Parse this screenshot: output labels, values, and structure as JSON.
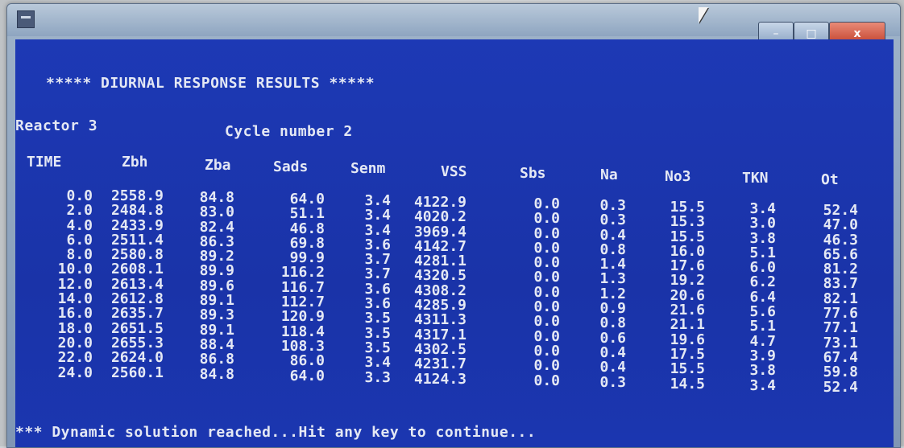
{
  "window": {
    "title": ""
  },
  "titlebar_buttons": {
    "minimize": "–",
    "maximize": "□",
    "close": "x"
  },
  "console": {
    "heading": "***** DIURNAL RESPONSE RESULTS *****",
    "reactor_label": "Reactor 3",
    "cycle_label": "Cycle number 2",
    "footer": "*** Dynamic solution reached...Hit any key to continue..."
  },
  "table": {
    "headers": [
      "TIME",
      "Zbh",
      "Zba",
      "Sads",
      "Senm",
      "VSS",
      "Sbs",
      "Na",
      "No3",
      "TKN",
      "Ot"
    ],
    "columns": {
      "time": [
        "0.0",
        "2.0",
        "4.0",
        "6.0",
        "8.0",
        "10.0",
        "12.0",
        "14.0",
        "16.0",
        "18.0",
        "20.0",
        "22.0",
        "24.0"
      ],
      "zbh": [
        "2558.9",
        "2484.8",
        "2433.9",
        "2511.4",
        "2580.8",
        "2608.1",
        "2613.4",
        "2612.8",
        "2635.7",
        "2651.5",
        "2655.3",
        "2624.0",
        "2560.1"
      ],
      "zba": [
        "84.8",
        "83.0",
        "82.4",
        "86.3",
        "89.2",
        "89.9",
        "89.6",
        "89.1",
        "89.3",
        "89.1",
        "88.4",
        "86.8",
        "84.8"
      ],
      "sads": [
        "64.0",
        "51.1",
        "46.8",
        "69.8",
        "99.9",
        "116.2",
        "116.7",
        "112.7",
        "120.9",
        "118.4",
        "108.3",
        "86.0",
        "64.0"
      ],
      "senm": [
        "3.4",
        "3.4",
        "3.4",
        "3.6",
        "3.7",
        "3.7",
        "3.6",
        "3.6",
        "3.5",
        "3.5",
        "3.5",
        "3.4",
        "3.3"
      ],
      "vss": [
        "4122.9",
        "4020.2",
        "3969.4",
        "4142.7",
        "4281.1",
        "4320.5",
        "4308.2",
        "4285.9",
        "4311.3",
        "4317.1",
        "4302.5",
        "4231.7",
        "4124.3"
      ],
      "sbs": [
        "0.0",
        "0.0",
        "0.0",
        "0.0",
        "0.0",
        "0.0",
        "0.0",
        "0.0",
        "0.0",
        "0.0",
        "0.0",
        "0.0",
        "0.0"
      ],
      "na": [
        "0.3",
        "0.3",
        "0.4",
        "0.8",
        "1.4",
        "1.3",
        "1.2",
        "0.9",
        "0.8",
        "0.6",
        "0.4",
        "0.4",
        "0.3"
      ],
      "no3": [
        "15.5",
        "15.3",
        "15.5",
        "16.0",
        "17.6",
        "19.2",
        "20.6",
        "21.6",
        "21.1",
        "19.6",
        "17.5",
        "15.5",
        "14.5"
      ],
      "tkn": [
        "3.4",
        "3.0",
        "3.8",
        "5.1",
        "6.0",
        "6.2",
        "6.4",
        "5.6",
        "5.1",
        "4.7",
        "3.9",
        "3.8",
        "3.4"
      ],
      "ot": [
        "52.4",
        "47.0",
        "46.3",
        "65.6",
        "81.2",
        "83.7",
        "82.1",
        "77.6",
        "77.1",
        "73.1",
        "67.4",
        "59.8",
        "52.4"
      ]
    }
  },
  "colors": {
    "console_bg": "#1d39b5",
    "console_text": "#e4e8f4"
  },
  "icons": {
    "app": "console-app-icon",
    "pointer": "mouse-cursor-icon"
  }
}
